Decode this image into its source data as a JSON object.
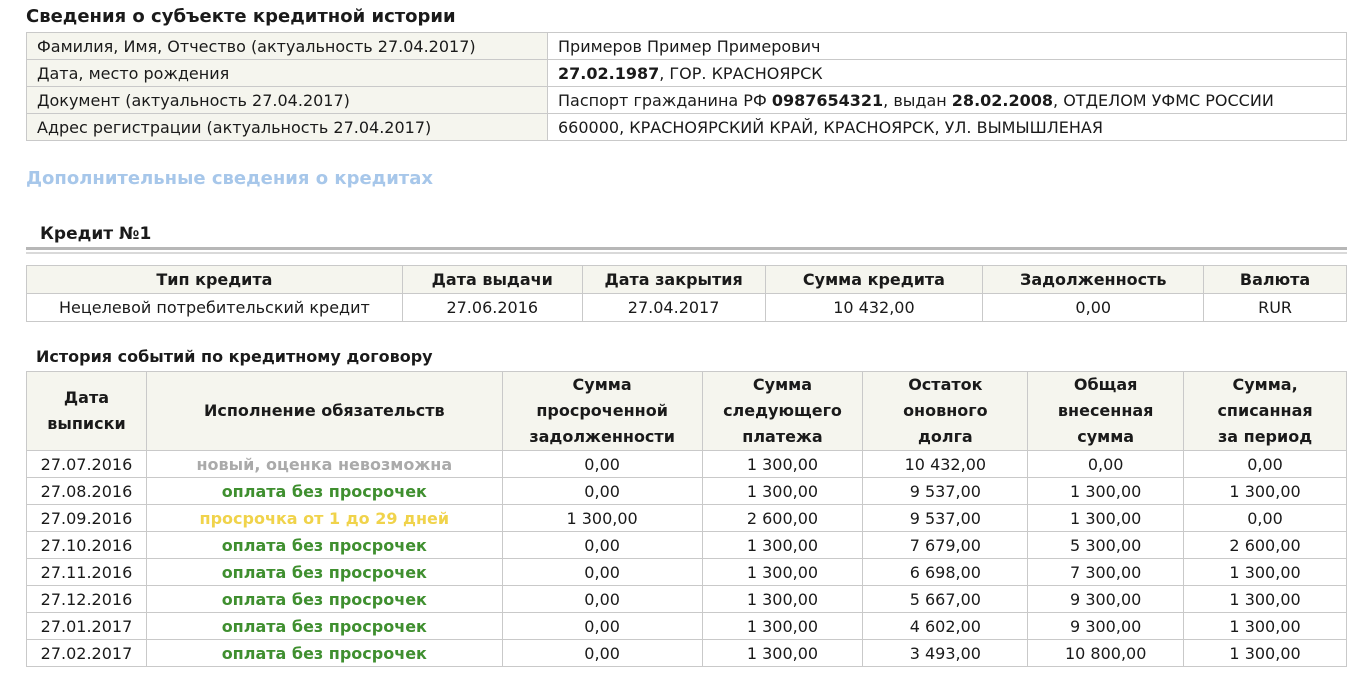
{
  "subject": {
    "title": "Сведения о субъекте кредитной истории",
    "rows": [
      {
        "label": "Фамилия, Имя, Отчество (актуальность 27.04.2017)",
        "value_parts": [
          {
            "text": "Примеров Пример Примерович",
            "bold": false
          }
        ]
      },
      {
        "label": "Дата, место рождения",
        "value_parts": [
          {
            "text": "27.02.1987",
            "bold": true
          },
          {
            "text": ", ГОР. КРАСНОЯРСК",
            "bold": false
          }
        ]
      },
      {
        "label": "Документ (актуальность 27.04.2017)",
        "value_parts": [
          {
            "text": "Паспорт гражданина РФ ",
            "bold": false
          },
          {
            "text": "0987654321",
            "bold": true
          },
          {
            "text": ", выдан ",
            "bold": false
          },
          {
            "text": "28.02.2008",
            "bold": true
          },
          {
            "text": ", ОТДЕЛОМ УФМС РОССИИ",
            "bold": false
          }
        ]
      },
      {
        "label": "Адрес регистрации (актуальность 27.04.2017)",
        "value_parts": [
          {
            "text": "660000, КРАСНОЯРСКИЙ КРАЙ, КРАСНОЯРСК, УЛ. ВЫМЫШЛЕНАЯ",
            "bold": false
          }
        ]
      }
    ]
  },
  "additional": {
    "title": "Дополнительные сведения о кредитах"
  },
  "credit": {
    "title": "Кредит №1",
    "headers": [
      "Тип кредита",
      "Дата выдачи",
      "Дата закрытия",
      "Сумма кредита",
      "Задолженность",
      "Валюта"
    ],
    "row": [
      "Нецелевой потребительский кредит",
      "27.06.2016",
      "27.04.2017",
      "10 432,00",
      "0,00",
      "RUR"
    ]
  },
  "history": {
    "title": "История событий по кредитному договору",
    "headers": [
      [
        "Дата",
        "выписки"
      ],
      [
        "Исполнение обязательств"
      ],
      [
        "Сумма",
        "просроченной",
        "задолженности"
      ],
      [
        "Сумма",
        "следующего",
        "платежа"
      ],
      [
        "Остаток",
        "оновного",
        "долга"
      ],
      [
        "Общая",
        "внесенная",
        "сумма"
      ],
      [
        "Сумма,",
        "списанная",
        "за период"
      ]
    ],
    "rows": [
      {
        "date": "27.07.2016",
        "status": "новый, оценка невозможна",
        "status_type": "new",
        "overdue": "0,00",
        "next": "1 300,00",
        "remaining": "10 432,00",
        "paid": "0,00",
        "written": "0,00"
      },
      {
        "date": "27.08.2016",
        "status": "оплата без просрочек",
        "status_type": "ok",
        "overdue": "0,00",
        "next": "1 300,00",
        "remaining": "9 537,00",
        "paid": "1 300,00",
        "written": "1 300,00"
      },
      {
        "date": "27.09.2016",
        "status": "просрочка от 1 до 29 дней",
        "status_type": "late",
        "overdue": "1 300,00",
        "next": "2 600,00",
        "remaining": "9 537,00",
        "paid": "1 300,00",
        "written": "0,00"
      },
      {
        "date": "27.10.2016",
        "status": "оплата без просрочек",
        "status_type": "ok",
        "overdue": "0,00",
        "next": "1 300,00",
        "remaining": "7 679,00",
        "paid": "5 300,00",
        "written": "2 600,00"
      },
      {
        "date": "27.11.2016",
        "status": "оплата без просрочек",
        "status_type": "ok",
        "overdue": "0,00",
        "next": "1 300,00",
        "remaining": "6 698,00",
        "paid": "7 300,00",
        "written": "1 300,00"
      },
      {
        "date": "27.12.2016",
        "status": "оплата без просрочек",
        "status_type": "ok",
        "overdue": "0,00",
        "next": "1 300,00",
        "remaining": "5 667,00",
        "paid": "9 300,00",
        "written": "1 300,00"
      },
      {
        "date": "27.01.2017",
        "status": "оплата без просрочек",
        "status_type": "ok",
        "overdue": "0,00",
        "next": "1 300,00",
        "remaining": "4 602,00",
        "paid": "9 300,00",
        "written": "1 300,00"
      },
      {
        "date": "27.02.2017",
        "status": "оплата без просрочек",
        "status_type": "ok",
        "overdue": "0,00",
        "next": "1 300,00",
        "remaining": "3 493,00",
        "paid": "10 800,00",
        "written": "1 300,00"
      }
    ]
  },
  "colors": {
    "header_bg": "#f5f5ee",
    "border": "#c9c9c9",
    "additional_title": "#a7c7ea",
    "status_ok": "#3f8f2f",
    "status_new": "#aaaaaa",
    "status_late": "#f0d34b"
  }
}
